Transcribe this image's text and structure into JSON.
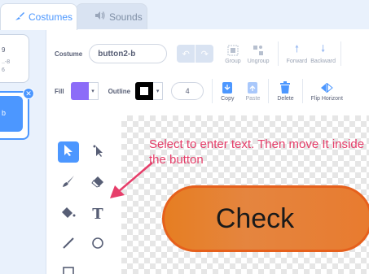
{
  "tabs": {
    "costumes": "Costumes",
    "sounds": "Sounds"
  },
  "costume_list": {
    "cards": [
      {
        "num": "9",
        "sub": "..-8",
        "extra": "6"
      },
      {
        "num": "",
        "sub": "b"
      }
    ]
  },
  "toolbar": {
    "costume_label": "Costume",
    "costume_name": "button2-b",
    "group": "Group",
    "ungroup": "Ungroup",
    "forward": "Forward",
    "backward": "Backward",
    "fill_label": "Fill",
    "outline_label": "Outline",
    "outline_width": "4",
    "copy": "Copy",
    "paste": "Paste",
    "delete": "Delete",
    "flip_horizontal": "Flip Horizont",
    "fill_color": "#8c6cf8",
    "outline_color": "#000000"
  },
  "canvas": {
    "hint": "Select to enter text. Then move It inside the button",
    "button_text": "Check",
    "hint_color": "#e63e6a"
  }
}
